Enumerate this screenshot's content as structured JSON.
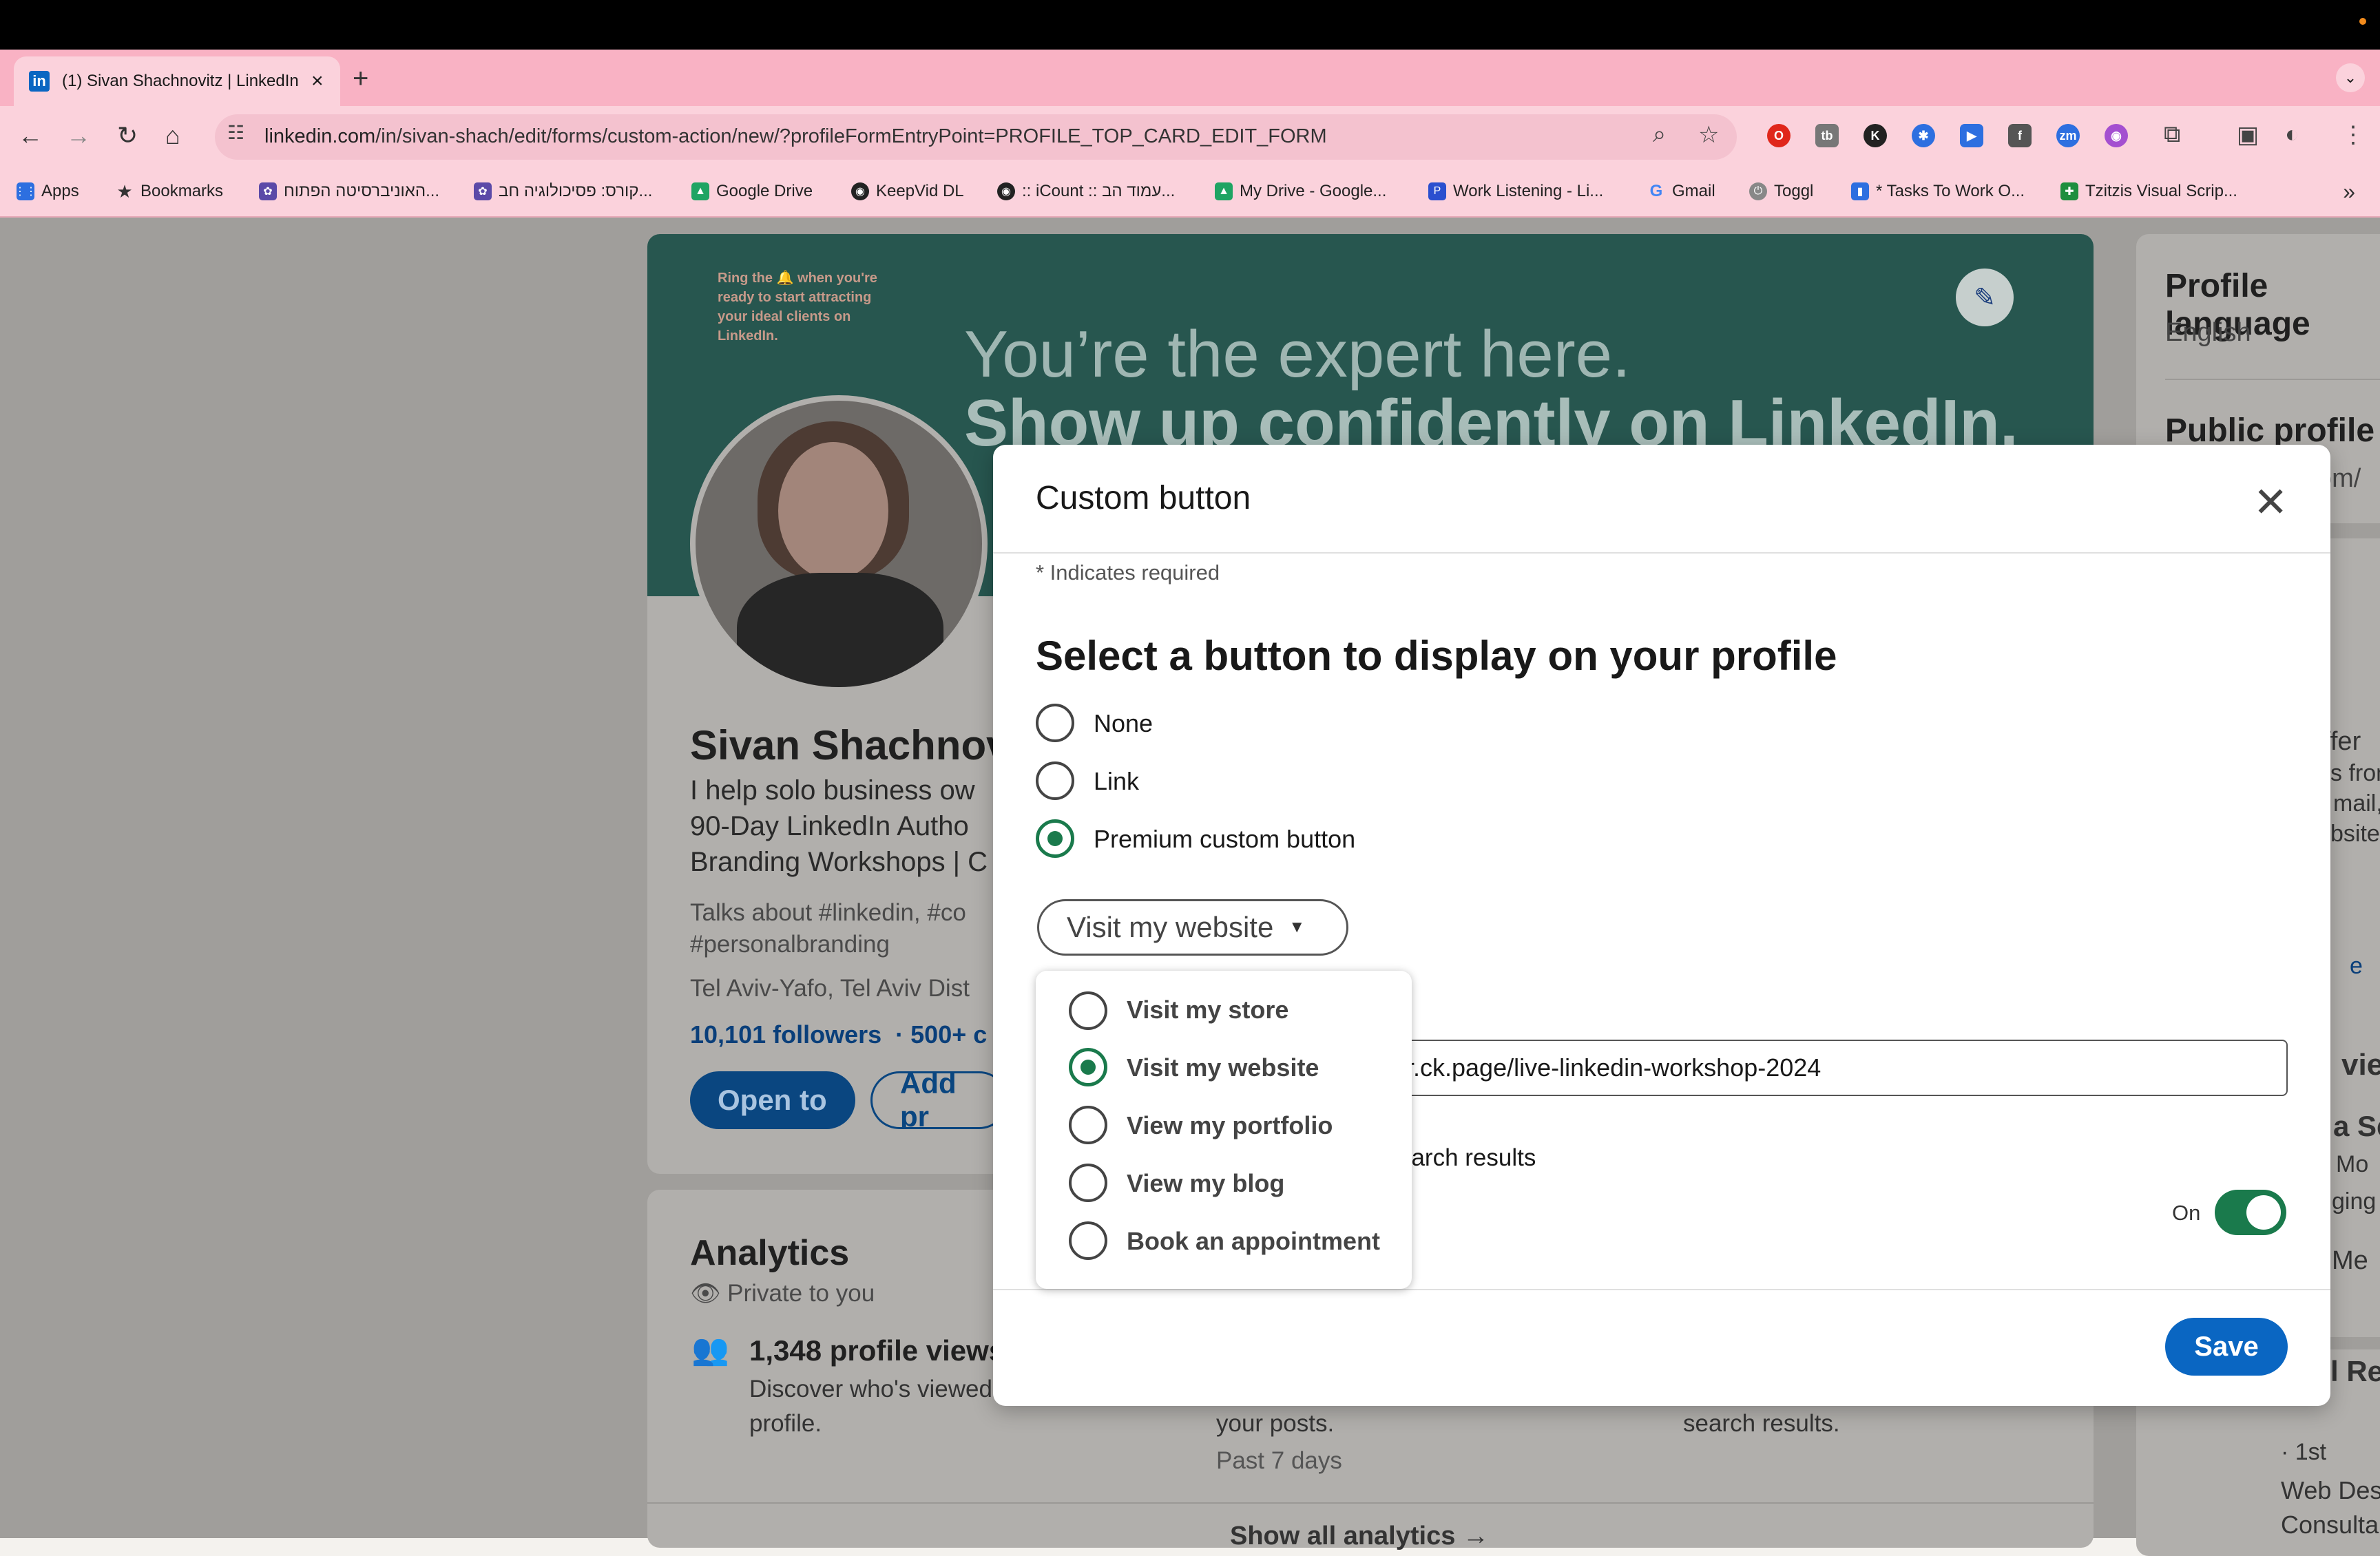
{
  "browser": {
    "tab_title": "(1) Sivan Shachnovitz | LinkedIn",
    "tab_favicon": "in",
    "new_tab": "+",
    "url_domain": "linkedin.com",
    "url_path": "/in/sivan-shach/edit/forms/custom-action/new/?profileFormEntryPoint=PROFILE_TOP_CARD_EDIT_FORM",
    "bookmarks": [
      {
        "label": "Apps",
        "icon": "apps-grid-icon"
      },
      {
        "label": "Bookmarks",
        "icon": "star-icon"
      },
      {
        "label": "האוניברסיטה הפתוח...",
        "icon": "university-icon"
      },
      {
        "label": "קורס: פסיכולוגיה חב...",
        "icon": "university-icon"
      },
      {
        "label": "Google Drive",
        "icon": "drive-icon"
      },
      {
        "label": "KeepVid DL",
        "icon": "keepvid-icon"
      },
      {
        "label": ":: iCount :: עמוד הב...",
        "icon": "icount-icon"
      },
      {
        "label": "My Drive - Google...",
        "icon": "drive-icon"
      },
      {
        "label": "Work Listening - Li...",
        "icon": "pandora-icon"
      },
      {
        "label": "Gmail",
        "icon": "google-icon"
      },
      {
        "label": "Toggl",
        "icon": "toggl-icon"
      },
      {
        "label": "* Tasks To Work O...",
        "icon": "monday-icon"
      },
      {
        "label": "Tzitzis Visual Scrip...",
        "icon": "sheets-icon"
      }
    ]
  },
  "profile": {
    "banner_small": "Ring the 🔔 when you're ready to start attracting your ideal clients on LinkedIn.",
    "banner_line1": "You’re the expert here.",
    "banner_line2": "Show up confidently on LinkedIn.",
    "name": "Sivan Shachnovitz",
    "headline1": "I help solo business ow",
    "headline2": "90-Day LinkedIn Autho",
    "headline3": "Branding Workshops | C",
    "talks1": "Talks about #linkedin, #co",
    "talks2": "#personalbranding",
    "location": "Tel Aviv-Yafo, Tel Aviv Dist",
    "followers": "10,101 followers",
    "connections": "· 500+ c",
    "open_to": "Open to",
    "add_pr": "Add pr"
  },
  "analytics": {
    "title": "Analytics",
    "private": "Private to you",
    "views": "1,348 profile views",
    "views_desc1": "Discover who's viewed your",
    "views_desc2": "profile.",
    "posts": "your posts.",
    "past": "Past 7 days",
    "search": "search results.",
    "show_all": "Show all analytics →"
  },
  "right": {
    "lang_title": "Profile language",
    "lang_value": "English",
    "public_title": "Public profile &",
    "public_url": "com/",
    "r1": "ffer",
    "r2": "s fron",
    "r3": "mail,",
    "r4": "bsite",
    "r5": "e",
    "r6": "vie",
    "r7": "a Se",
    "r8": "Mo",
    "r9": "ging",
    "r10": "Me",
    "r11": "l Re",
    "r12": "· 1st",
    "r13": "Web Des",
    "r14": "Consulta"
  },
  "modal": {
    "title": "Custom button",
    "required_note": "* Indicates required",
    "section_title": "Select a button to display on your profile",
    "options": [
      {
        "label": "None",
        "selected": false
      },
      {
        "label": "Link",
        "selected": false
      },
      {
        "label": "Premium custom button",
        "selected": true
      }
    ],
    "dropdown_value": "Visit my website",
    "dropdown_options": [
      {
        "label": "Visit my store",
        "selected": false
      },
      {
        "label": "Visit my website",
        "selected": true
      },
      {
        "label": "View my portfolio",
        "selected": false
      },
      {
        "label": "View my blog",
        "selected": false
      },
      {
        "label": "Book an appointment",
        "selected": false
      }
    ],
    "url_value": "r.ck.page/live-linkedin-workshop-2024",
    "search_results_text": "earch results",
    "toggle_label": "On",
    "toggle_on": true,
    "save_label": "Save"
  },
  "colors": {
    "accent": "#0a66c2",
    "selected_green": "#1a7a4c",
    "tab_strip": "#f9b2c4"
  }
}
